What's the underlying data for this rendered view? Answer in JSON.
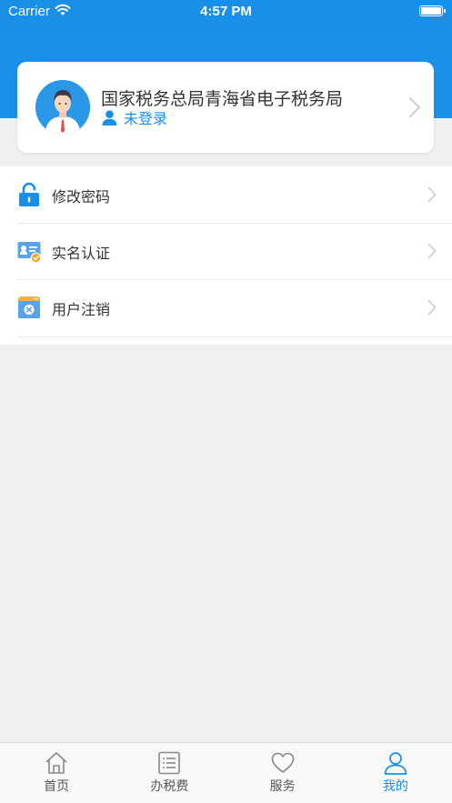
{
  "status_bar": {
    "carrier": "Carrier",
    "time": "4:57 PM"
  },
  "profile": {
    "org_name": "国家税务总局青海省电子税务局",
    "login_status": "未登录",
    "avatar_icon": "user-avatar-icon",
    "status_icon": "person-icon"
  },
  "menu": {
    "items": [
      {
        "label": "修改密码",
        "icon": "lock-icon"
      },
      {
        "label": "实名认证",
        "icon": "id-card-icon"
      },
      {
        "label": "用户注销",
        "icon": "cancel-account-icon"
      }
    ]
  },
  "tabs": [
    {
      "label": "首页",
      "icon": "home-icon",
      "active": false
    },
    {
      "label": "办税费",
      "icon": "list-icon",
      "active": false
    },
    {
      "label": "服务",
      "icon": "heart-icon",
      "active": false
    },
    {
      "label": "我的",
      "icon": "person-icon",
      "active": true
    }
  ],
  "colors": {
    "accent": "#1a8fe6",
    "background": "#efefef",
    "text": "#333333"
  }
}
